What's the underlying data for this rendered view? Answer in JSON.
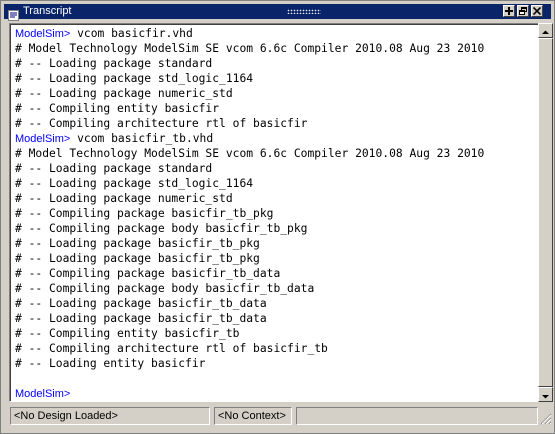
{
  "window": {
    "title": "Transcript"
  },
  "transcript": {
    "prompt_label": "ModelSim>",
    "lines": [
      {
        "prompt": "ModelSim>",
        "text": " vcom basicfir.vhd"
      },
      {
        "prompt": "",
        "text": "# Model Technology ModelSim SE vcom 6.6c Compiler 2010.08 Aug 23 2010"
      },
      {
        "prompt": "",
        "text": "# -- Loading package standard"
      },
      {
        "prompt": "",
        "text": "# -- Loading package std_logic_1164"
      },
      {
        "prompt": "",
        "text": "# -- Loading package numeric_std"
      },
      {
        "prompt": "",
        "text": "# -- Compiling entity basicfir"
      },
      {
        "prompt": "",
        "text": "# -- Compiling architecture rtl of basicfir"
      },
      {
        "prompt": "ModelSim>",
        "text": " vcom basicfir_tb.vhd"
      },
      {
        "prompt": "",
        "text": "# Model Technology ModelSim SE vcom 6.6c Compiler 2010.08 Aug 23 2010"
      },
      {
        "prompt": "",
        "text": "# -- Loading package standard"
      },
      {
        "prompt": "",
        "text": "# -- Loading package std_logic_1164"
      },
      {
        "prompt": "",
        "text": "# -- Loading package numeric_std"
      },
      {
        "prompt": "",
        "text": "# -- Compiling package basicfir_tb_pkg"
      },
      {
        "prompt": "",
        "text": "# -- Compiling package body basicfir_tb_pkg"
      },
      {
        "prompt": "",
        "text": "# -- Loading package basicfir_tb_pkg"
      },
      {
        "prompt": "",
        "text": "# -- Loading package basicfir_tb_pkg"
      },
      {
        "prompt": "",
        "text": "# -- Compiling package basicfir_tb_data"
      },
      {
        "prompt": "",
        "text": "# -- Compiling package body basicfir_tb_data"
      },
      {
        "prompt": "",
        "text": "# -- Loading package basicfir_tb_data"
      },
      {
        "prompt": "",
        "text": "# -- Loading package basicfir_tb_data"
      },
      {
        "prompt": "",
        "text": "# -- Compiling entity basicfir_tb"
      },
      {
        "prompt": "",
        "text": "# -- Compiling architecture rtl of basicfir_tb"
      },
      {
        "prompt": "",
        "text": "# -- Loading entity basicfir"
      },
      {
        "prompt": "",
        "text": ""
      },
      {
        "prompt": "ModelSim>",
        "text": ""
      }
    ]
  },
  "statusbar": {
    "design": "<No Design Loaded>",
    "context": "<No Context>",
    "extra": ""
  },
  "icons": {
    "title": "transcript-icon",
    "add": "plus-icon",
    "undock": "undock-icon",
    "close": "close-icon"
  },
  "colors": {
    "titlebar": "#0a246a",
    "prompt": "#0000ff",
    "background": "#d4d0c8"
  }
}
